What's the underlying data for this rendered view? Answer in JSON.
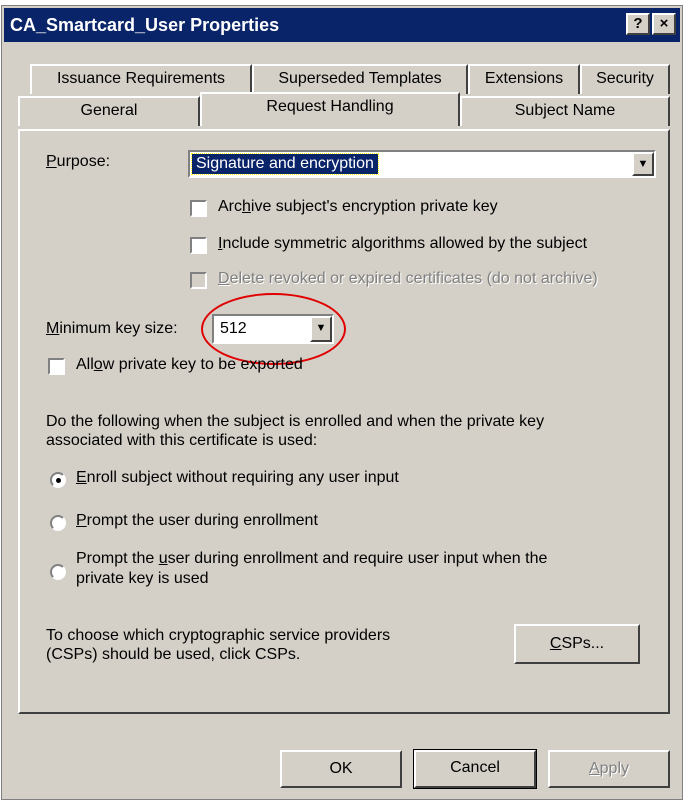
{
  "window": {
    "title": "CA_Smartcard_User Properties",
    "help_button": "?",
    "close_button": "×"
  },
  "tabs": {
    "row1": [
      "Issuance Requirements",
      "Superseded Templates",
      "Extensions",
      "Security"
    ],
    "row2": [
      "General",
      "Request Handling",
      "Subject Name"
    ],
    "active": "Request Handling"
  },
  "purpose": {
    "label_prefix": "",
    "label_ul": "P",
    "label_rest": "urpose:",
    "value": "Signature and encryption"
  },
  "checkboxes": {
    "archive": {
      "pre": "Arc",
      "ul": "h",
      "post": "ive subject's encryption private key",
      "checked": false
    },
    "symmetric": {
      "pre": "",
      "ul": "I",
      "post": "nclude symmetric algorithms allowed by the subject",
      "checked": false
    },
    "delete_revoked": {
      "pre": "",
      "ul": "D",
      "post": "elete revoked or expired certificates (do not archive)",
      "checked": false,
      "disabled": true
    },
    "allow_export": {
      "pre": "All",
      "ul": "o",
      "post": "w private key to be exported",
      "checked": false
    }
  },
  "key_size": {
    "label_pre": "",
    "label_ul": "M",
    "label_post": "inimum key size:",
    "value": "512"
  },
  "enroll": {
    "description_line1": "Do the following when the subject is enrolled and when the private key",
    "description_line2": "associated with this certificate is used:",
    "option1": {
      "pre": "",
      "ul": "E",
      "post": "nroll subject without requiring any user input",
      "selected": true
    },
    "option2": {
      "pre": "",
      "ul": "P",
      "post": "rompt the user during enrollment",
      "selected": false
    },
    "option3": {
      "pre": "Prompt the ",
      "ul": "u",
      "post": "ser during enrollment and require user input when the",
      "line2": "private key is used",
      "selected": false
    }
  },
  "csp": {
    "text_line1": "To choose which cryptographic service providers",
    "text_line2": "(CSPs) should be used, click CSPs.",
    "button_ul": "C",
    "button_rest": "SPs..."
  },
  "buttons": {
    "ok": "OK",
    "cancel": "Cancel",
    "apply_ul": "A",
    "apply_rest": "pply"
  },
  "colors": {
    "titlebar": "#0a246a",
    "dialog": "#d4d0c8",
    "highlight": "#0a246a",
    "annotation": "#e00000"
  }
}
